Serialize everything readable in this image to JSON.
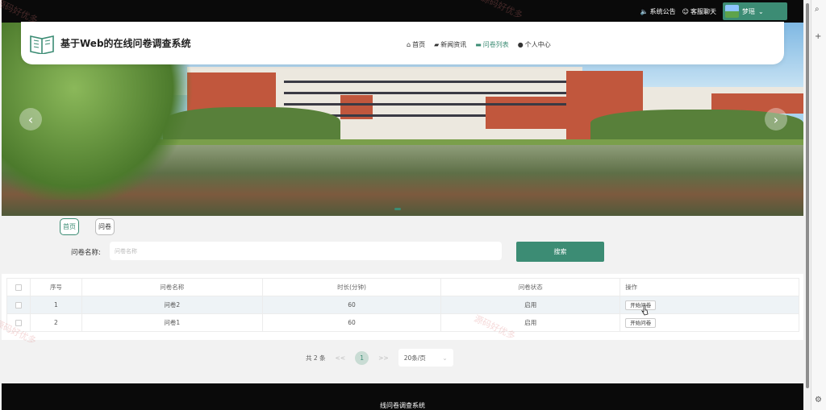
{
  "topbar": {
    "announcement": "系统公告",
    "service_chat": "客服聊天",
    "username": "梦瑶"
  },
  "header": {
    "title": "基于Web的在线问卷调查系统",
    "nav": [
      {
        "label": "首页",
        "icon": "home-icon"
      },
      {
        "label": "新闻资讯",
        "icon": "news-icon"
      },
      {
        "label": "问卷列表",
        "icon": "list-icon"
      },
      {
        "label": "个人中心",
        "icon": "person-icon"
      }
    ],
    "active_nav": "问卷列表"
  },
  "breadcrumb_tabs": [
    "首页",
    "问卷"
  ],
  "search": {
    "label": "问卷名称:",
    "placeholder": "问卷名称",
    "button": "搜索"
  },
  "table": {
    "headers": [
      "序号",
      "问卷名称",
      "时长(分钟)",
      "问卷状态",
      "操作"
    ],
    "rows": [
      {
        "index": "1",
        "name": "问卷2",
        "duration": "60",
        "status": "启用",
        "action": "开始问卷"
      },
      {
        "index": "2",
        "name": "问卷1",
        "duration": "60",
        "status": "启用",
        "action": "开始问卷"
      }
    ]
  },
  "pager": {
    "total": "共 2 条",
    "prev": "<<",
    "current": "1",
    "next": ">>",
    "page_size": "20条/页"
  },
  "footer": {
    "text": "线问卷调查系统"
  },
  "watermark": "源码好优多",
  "colors": {
    "accent": "#3c8c74",
    "topbar": "#0a0a0a"
  }
}
